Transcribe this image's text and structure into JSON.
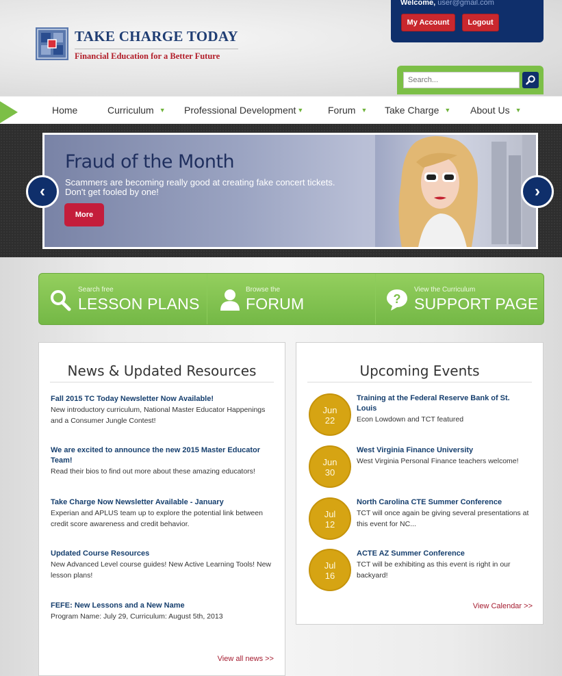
{
  "header": {
    "logo_title": "TAKE CHARGE TODAY",
    "logo_tagline": "Financial Education for a Better Future",
    "welcome_label": "Welcome,",
    "welcome_email": "user@gmail.com",
    "my_account": "My Account",
    "logout": "Logout",
    "search_placeholder": "Search..."
  },
  "nav": {
    "items": [
      {
        "label": "Home"
      },
      {
        "label": "Curriculum"
      },
      {
        "label": "Professional Development"
      },
      {
        "label": "Forum"
      },
      {
        "label": "Take Charge"
      },
      {
        "label": "About Us"
      }
    ]
  },
  "hero": {
    "title": "Fraud of the Month",
    "text": "Scammers are becoming really good at creating fake concert tickets. Don't get fooled by one!",
    "more": "More",
    "prev": "‹",
    "next": "›"
  },
  "quicklinks": [
    {
      "small": "Search free",
      "big": "LESSON PLANS",
      "icon": "search-icon"
    },
    {
      "small": "Browse the",
      "big": "FORUM",
      "icon": "user-icon"
    },
    {
      "small": "View the Curriculum",
      "big": "SUPPORT PAGE",
      "icon": "help-icon"
    }
  ],
  "news": {
    "title": "News & Updated Resources",
    "items": [
      {
        "title": "Fall 2015 TC Today Newsletter Now Available!",
        "desc": "New introductory curriculum, National Master Educator Happenings and a Consumer Jungle Contest!"
      },
      {
        "title": "We are excited to announce the new 2015 Master Educator Team!",
        "desc": "Read their bios to find out more about these amazing educators!"
      },
      {
        "title": "Take Charge Now Newsletter Available - January",
        "desc": "Experian and APLUS team up to explore the potential link between credit score awareness and credit behavior."
      },
      {
        "title": "Updated Course Resources",
        "desc": "New Advanced Level course guides! New Active Learning Tools! New lesson plans!"
      },
      {
        "title": "FEFE: New Lessons and a New Name",
        "desc": "Program Name: July 29, Curriculum: August 5th, 2013"
      }
    ],
    "view_all": "View all news >>"
  },
  "events": {
    "title": "Upcoming Events",
    "items": [
      {
        "month": "Jun",
        "day": "22",
        "title": "Training at the Federal Reserve Bank of St. Louis",
        "desc": "Econ Lowdown and TCT featured"
      },
      {
        "month": "Jun",
        "day": "30",
        "title": "West Virginia Finance University",
        "desc": "West Virginia Personal Finance teachers welcome!"
      },
      {
        "month": "Jul",
        "day": "12",
        "title": "North Carolina CTE Summer Conference",
        "desc": "TCT will once again be giving several presentations at this event for NC..."
      },
      {
        "month": "Jul",
        "day": "16",
        "title": "ACTE AZ Summer Conference",
        "desc": "TCT will be exhibiting as this event is right in our backyard!"
      }
    ],
    "view_calendar": "View Calendar >>"
  }
}
